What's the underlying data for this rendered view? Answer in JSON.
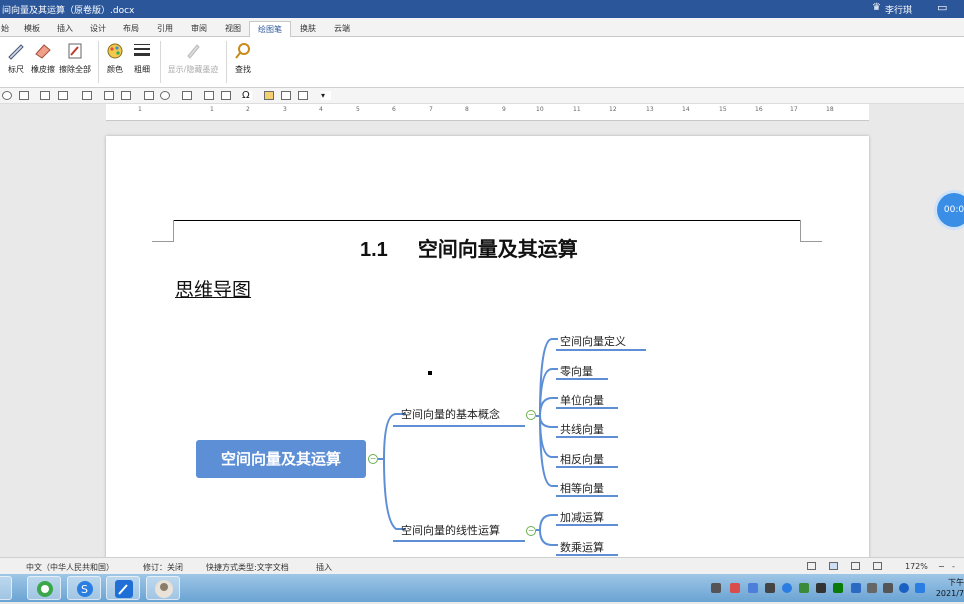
{
  "window": {
    "title": "间向量及其运算（原卷版）.docx",
    "user": "李行琪"
  },
  "tabs": [
    "始",
    "模板",
    "插入",
    "设计",
    "布局",
    "引用",
    "审阅",
    "视图",
    "绘图笔",
    "换肤",
    "云端"
  ],
  "active_tab": "绘图笔",
  "ribbon": {
    "ruler_label": "标尺",
    "eraser_label": "橡皮擦",
    "clear_all_label": "擦除全部",
    "color_label": "颜色",
    "thickness_label": "粗细",
    "toggle_ink_label": "显示/隐藏墨迹",
    "search_label": "查找"
  },
  "ruler": {
    "marks": [
      "1",
      "1",
      "2",
      "3",
      "4",
      "5",
      "6",
      "7",
      "8",
      "9",
      "10",
      "11",
      "12",
      "13",
      "14",
      "15",
      "16",
      "17",
      "18"
    ]
  },
  "document": {
    "heading_number": "1.1",
    "heading_title": "空间向量及其运算",
    "subheading": "思维导图",
    "mindmap": {
      "root": "空间向量及其运算",
      "branch1": {
        "label": "空间向量的基本概念",
        "children": [
          "空间向量定义",
          "零向量",
          "单位向量",
          "共线向量",
          "相反向量",
          "相等向量"
        ]
      },
      "branch2": {
        "label": "空间向量的线性运算",
        "children": [
          "加减运算",
          "数乘运算"
        ]
      }
    }
  },
  "timer": "00:0",
  "statusbar": {
    "language": "中文（中华人民共和国）",
    "revision": "修订：关闭",
    "track_type": "快捷方式类型:文字文档",
    "insert_mode": "插入",
    "zoom": "172%"
  },
  "clock": {
    "time": "下午",
    "date": "2021/7"
  }
}
